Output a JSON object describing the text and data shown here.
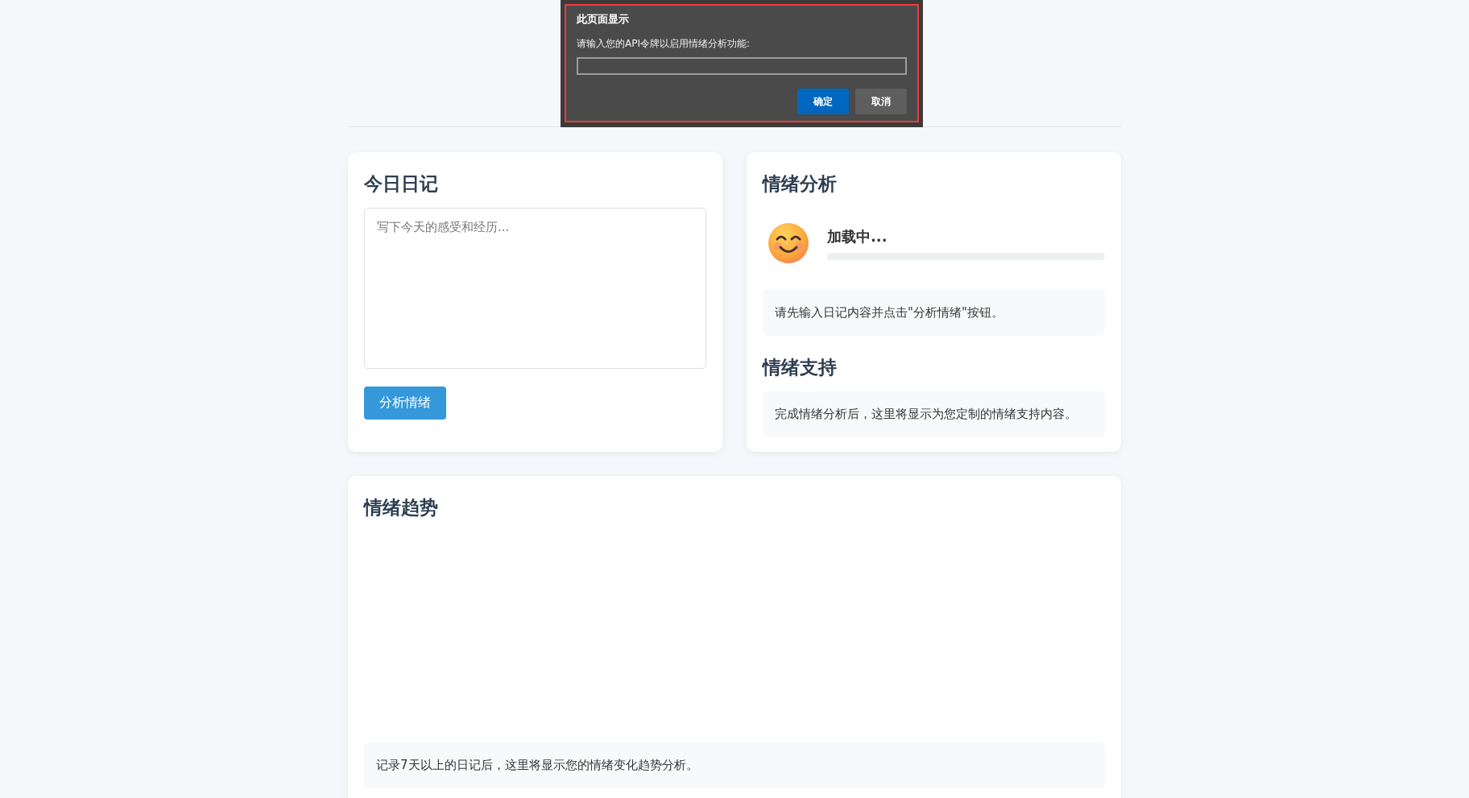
{
  "dialog": {
    "title": "此页面显示",
    "message": "请输入您的API令牌以启用情绪分析功能:",
    "buttons": [
      {
        "label": "确定",
        "kind": "primary"
      },
      {
        "label": "取消",
        "kind": "secondary"
      }
    ]
  },
  "diary": {
    "title": "今日日记",
    "placeholder": "写下今天的感受和经历...",
    "button": "分析情绪"
  },
  "analysis": {
    "title": "情绪分析",
    "status": "加载中...",
    "level": 0,
    "message": "请先输入日记内容并点击\"分析情绪\"按钮。"
  },
  "support": {
    "title": "情绪支持",
    "message": "完成情绪分析后，这里将显示为您定制的情绪支持内容。"
  },
  "trend": {
    "title": "情绪趋势",
    "message": "记录7天以上的日记后，这里将显示您的情绪变化趋势分析。"
  }
}
